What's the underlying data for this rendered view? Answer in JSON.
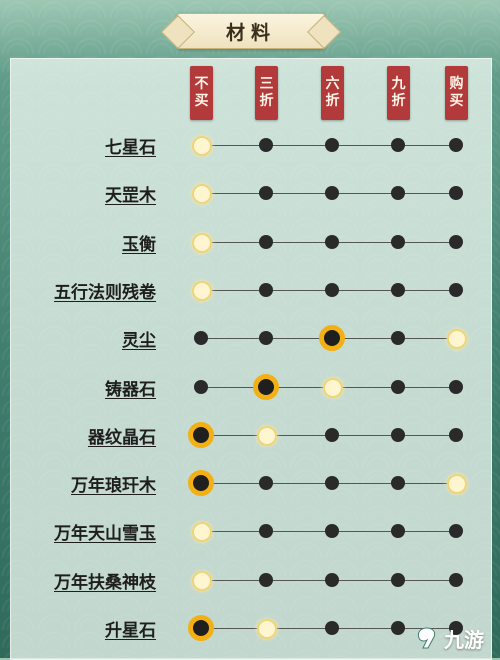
{
  "title": "材料",
  "columns": [
    {
      "top": "不",
      "bottom": "买"
    },
    {
      "top": "三",
      "bottom": "折"
    },
    {
      "top": "六",
      "bottom": "折"
    },
    {
      "top": "九",
      "bottom": "折"
    },
    {
      "top": "购",
      "bottom": "买"
    }
  ],
  "rows": [
    {
      "label": "七星石",
      "states": [
        "light",
        "dark",
        "dark",
        "dark",
        "dark"
      ]
    },
    {
      "label": "天罡木",
      "states": [
        "light",
        "dark",
        "dark",
        "dark",
        "dark"
      ]
    },
    {
      "label": "玉衡",
      "states": [
        "light",
        "dark",
        "dark",
        "dark",
        "dark"
      ]
    },
    {
      "label": "五行法则残卷",
      "states": [
        "light",
        "dark",
        "dark",
        "dark",
        "dark"
      ]
    },
    {
      "label": "灵尘",
      "states": [
        "dark",
        "dark",
        "selected",
        "dark",
        "light"
      ]
    },
    {
      "label": "铸器石",
      "states": [
        "dark",
        "selected",
        "light",
        "dark",
        "dark"
      ]
    },
    {
      "label": "器纹晶石",
      "states": [
        "selected",
        "light",
        "dark",
        "dark",
        "dark"
      ]
    },
    {
      "label": "万年琅玕木",
      "states": [
        "selected",
        "dark",
        "dark",
        "dark",
        "light"
      ]
    },
    {
      "label": "万年天山雪玉",
      "states": [
        "light",
        "dark",
        "dark",
        "dark",
        "dark"
      ]
    },
    {
      "label": "万年扶桑神枝",
      "states": [
        "light",
        "dark",
        "dark",
        "dark",
        "dark"
      ]
    },
    {
      "label": "升星石",
      "states": [
        "selected",
        "light",
        "dark",
        "dark",
        "dark"
      ]
    }
  ],
  "watermark": "九游",
  "icons": {
    "watermark_logo": "swirl-logo-icon"
  }
}
